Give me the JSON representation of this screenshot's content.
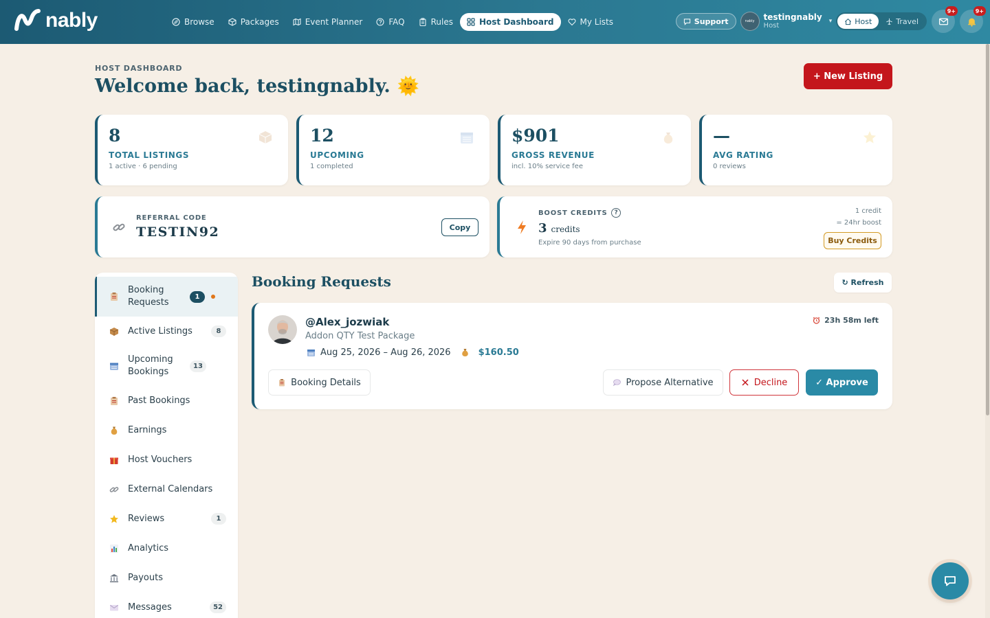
{
  "brand": {
    "name": "nably"
  },
  "nav": {
    "items": [
      {
        "label": "Browse",
        "icon": "compass-icon"
      },
      {
        "label": "Packages",
        "icon": "box-icon"
      },
      {
        "label": "Event Planner",
        "icon": "map-icon"
      },
      {
        "label": "FAQ",
        "icon": "help-circle-icon"
      },
      {
        "label": "Rules",
        "icon": "clipboard-icon"
      },
      {
        "label": "Host Dashboard",
        "icon": "grid-icon",
        "active": true
      },
      {
        "label": "My Lists",
        "icon": "heart-icon"
      }
    ],
    "support_label": "Support",
    "user": {
      "avatar_text": "nably",
      "name": "testingnably",
      "role": "Host"
    },
    "modes": [
      {
        "label": "Host",
        "active": true
      },
      {
        "label": "Travel",
        "active": false
      }
    ],
    "mail_badge": "9+",
    "bell_badge": "9+"
  },
  "header": {
    "eyebrow": "HOST DASHBOARD",
    "welcome": "Welcome back, testingnably.",
    "welcome_emoji": "🌞",
    "new_listing_label": "+ New Listing"
  },
  "stats": [
    {
      "value": "8",
      "label": "TOTAL LISTINGS",
      "sub": "1 active · 6 pending",
      "icon": "box-icon"
    },
    {
      "value": "12",
      "label": "UPCOMING",
      "sub": "1 completed",
      "icon": "calendar-icon"
    },
    {
      "value": "$901",
      "label": "GROSS REVENUE",
      "sub": "incl. 10% service fee",
      "icon": "money-bag-icon"
    },
    {
      "value": "—",
      "label": "AVG RATING",
      "sub": "0 reviews",
      "icon": "star-icon"
    }
  ],
  "referral": {
    "label": "REFERRAL CODE",
    "code": "TESTIN92",
    "copy_label": "Copy"
  },
  "boost": {
    "label": "BOOST CREDITS",
    "help": "?",
    "count": "3",
    "unit": "credits",
    "sub": "Expire 90 days from purchase",
    "rate_line1": "1 credit",
    "rate_line2": "= 24hr boost",
    "buy_label": "Buy Credits"
  },
  "sidebar": {
    "items": [
      {
        "label": "Booking Requests",
        "count": "1",
        "active": true,
        "icon": "clipboard-icon",
        "dot": true
      },
      {
        "label": "Active Listings",
        "count": "8",
        "icon": "box-icon"
      },
      {
        "label": "Upcoming Bookings",
        "count": "13",
        "icon": "calendar-icon"
      },
      {
        "label": "Past Bookings",
        "count": "",
        "icon": "clipboard-icon"
      },
      {
        "label": "Earnings",
        "count": "",
        "icon": "money-bag-icon"
      },
      {
        "label": "Host Vouchers",
        "count": "",
        "icon": "gift-icon"
      },
      {
        "label": "External Calendars",
        "count": "",
        "icon": "link-icon"
      },
      {
        "label": "Reviews",
        "count": "1",
        "icon": "star-icon"
      },
      {
        "label": "Analytics",
        "count": "",
        "icon": "bar-chart-icon"
      },
      {
        "label": "Payouts",
        "count": "",
        "icon": "bank-icon"
      },
      {
        "label": "Messages",
        "count": "52",
        "icon": "envelope-icon"
      }
    ]
  },
  "main": {
    "title": "Booking Requests",
    "refresh_label": "↻ Refresh",
    "requests": [
      {
        "user": "@Alex_jozwiak",
        "package": "Addon QTY Test Package",
        "dates": "Aug 25, 2026 – Aug 26, 2026",
        "price": "$160.50",
        "time_left": "23h 58m left",
        "details_label": "Booking Details",
        "propose_label": "Propose Alternative",
        "decline_label": "Decline",
        "approve_label": "✓ Approve"
      }
    ]
  },
  "colors": {
    "primary": "#1c5a73",
    "accent": "#2a8aa6",
    "danger": "#c4161c",
    "background": "#f6efe6"
  }
}
